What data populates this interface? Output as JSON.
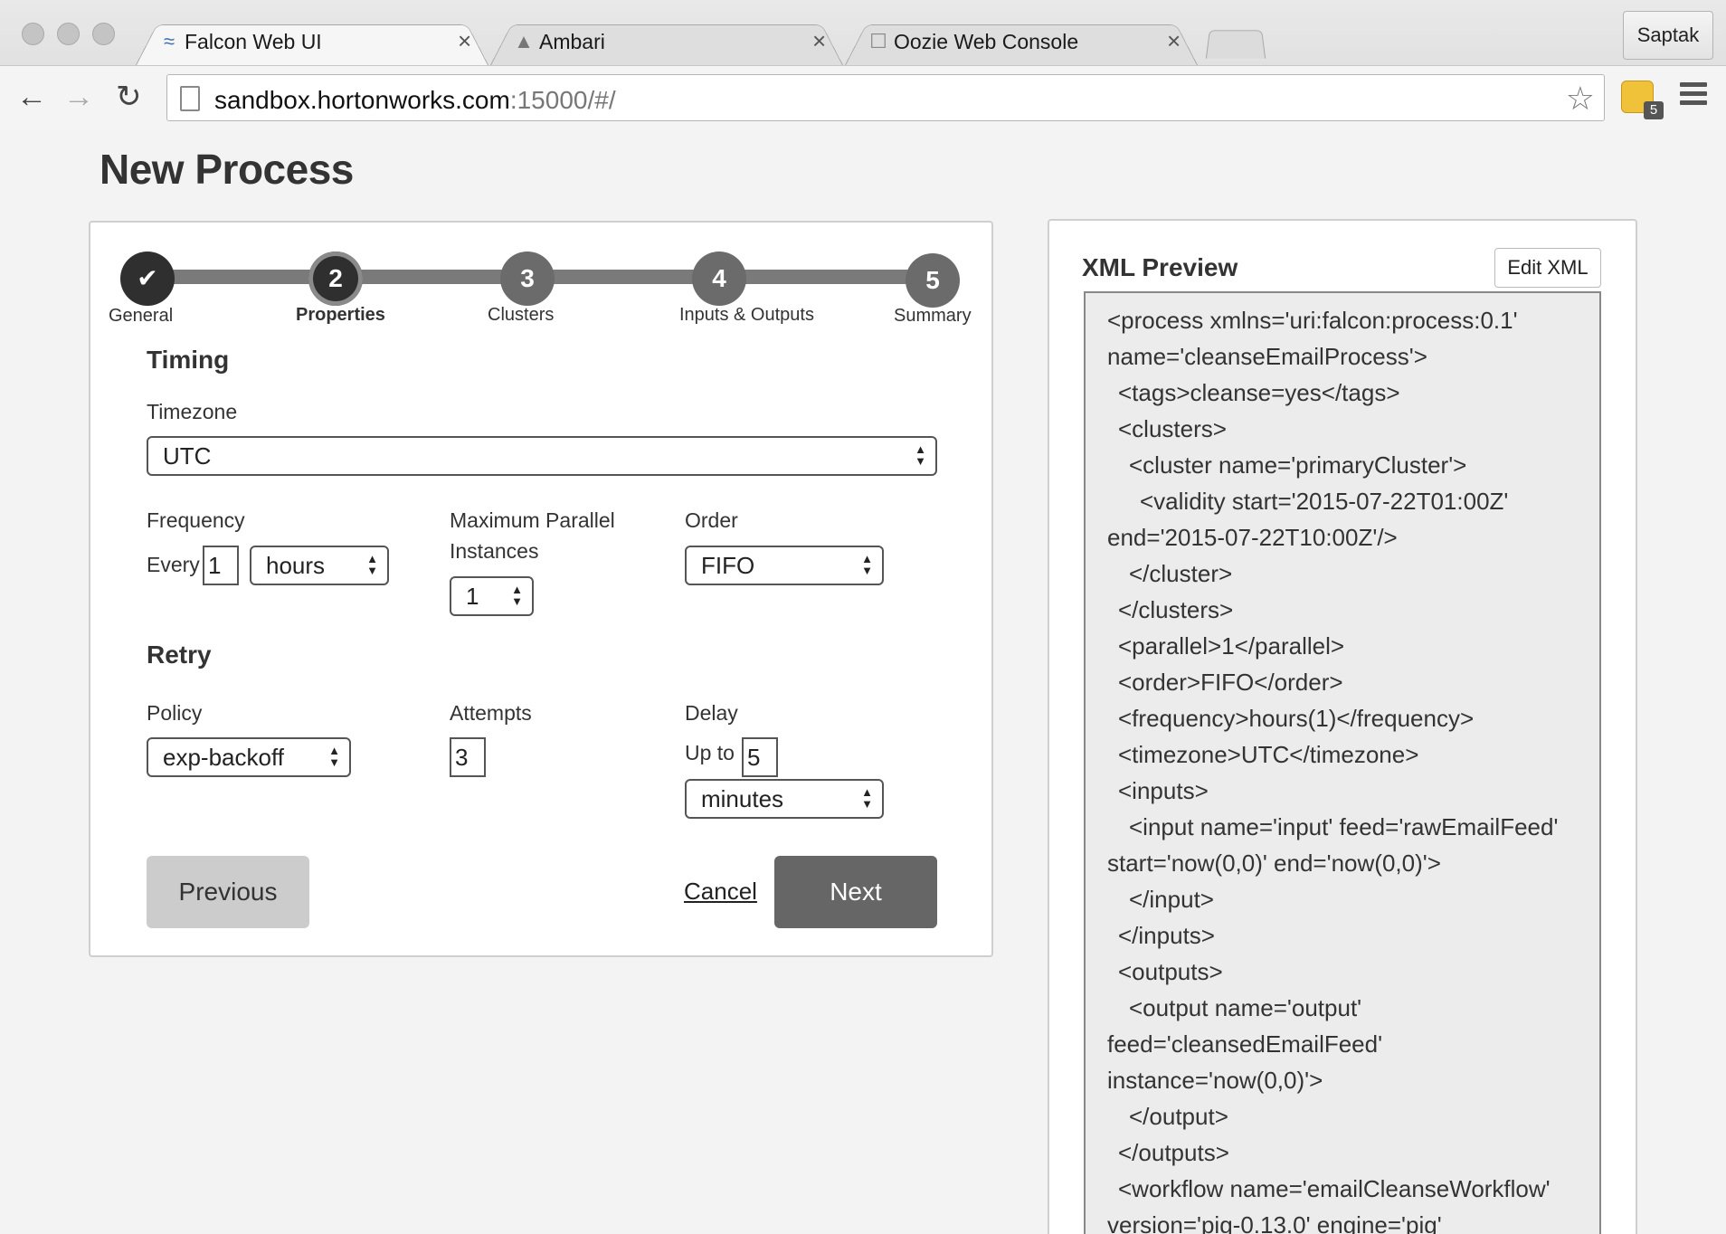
{
  "browser": {
    "tabs": [
      {
        "title": "Falcon Web UI",
        "icon": "falcon-icon",
        "active": true
      },
      {
        "title": "Ambari",
        "icon": "ambari-icon",
        "active": false
      },
      {
        "title": "Oozie Web Console",
        "icon": "page-icon",
        "active": false
      }
    ],
    "profile_name": "Saptak",
    "url_host": "sandbox.hortonworks.com",
    "url_path": ":15000/#/",
    "extension_badge": "5"
  },
  "page": {
    "title": "New Process"
  },
  "wizard": {
    "steps": [
      {
        "number": "",
        "label": "General",
        "state": "done"
      },
      {
        "number": "2",
        "label": "Properties",
        "state": "active"
      },
      {
        "number": "3",
        "label": "Clusters",
        "state": "todo"
      },
      {
        "number": "4",
        "label": "Inputs & Outputs",
        "state": "todo"
      },
      {
        "number": "5",
        "label": "Summary",
        "state": "todo"
      }
    ],
    "timing": {
      "section_title": "Timing",
      "timezone_label": "Timezone",
      "timezone_value": "UTC",
      "frequency_label": "Frequency",
      "every_label": "Every",
      "every_value": "1",
      "frequency_unit": "hours",
      "max_parallel_label_1": "Maximum Parallel",
      "max_parallel_label_2": "Instances",
      "max_parallel_value": "1",
      "order_label": "Order",
      "order_value": "FIFO"
    },
    "retry": {
      "section_title": "Retry",
      "policy_label": "Policy",
      "policy_value": "exp-backoff",
      "attempts_label": "Attempts",
      "attempts_value": "3",
      "delay_label": "Delay",
      "upto_label": "Up to",
      "delay_value": "5",
      "delay_unit": "minutes"
    },
    "buttons": {
      "previous": "Previous",
      "cancel": "Cancel",
      "next": "Next"
    }
  },
  "xml_preview": {
    "title": "XML Preview",
    "edit_button": "Edit XML",
    "lines": [
      "<process xmlns='uri:falcon:process:0.1'",
      "name='cleanseEmailProcess'>",
      "  <tags>cleanse=yes</tags>",
      "  <clusters>",
      "    <cluster name='primaryCluster'>",
      "      <validity start='2015-07-22T01:00Z'",
      "end='2015-07-22T10:00Z'/>",
      "    </cluster>",
      "  </clusters>",
      "  <parallel>1</parallel>",
      "  <order>FIFO</order>",
      "  <frequency>hours(1)</frequency>",
      "  <timezone>UTC</timezone>",
      "  <inputs>",
      "    <input name='input' feed='rawEmailFeed'",
      "start='now(0,0)' end='now(0,0)'>",
      "    </input>",
      "  </inputs>",
      "  <outputs>",
      "    <output name='output'",
      "feed='cleansedEmailFeed'",
      "instance='now(0,0)'>",
      "    </output>",
      "  </outputs>",
      "  <workflow name='emailCleanseWorkflow'",
      "version='pig-0.13.0' engine='pig'"
    ]
  }
}
